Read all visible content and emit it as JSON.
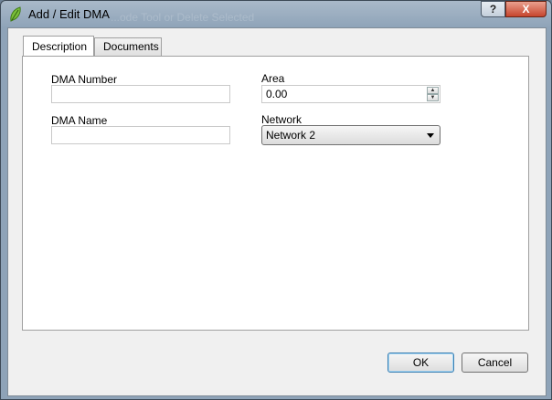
{
  "window": {
    "title": "Add / Edit DMA",
    "background_hint": "...ode Tool or Delete Selected",
    "help_label": "?",
    "close_label": "X",
    "app_icon": "qgis-leaf-icon"
  },
  "tabs": [
    {
      "label": "Description",
      "active": true
    },
    {
      "label": "Documents",
      "active": false
    }
  ],
  "form": {
    "dma_number": {
      "label": "DMA Number",
      "value": ""
    },
    "dma_name": {
      "label": "DMA Name",
      "value": ""
    },
    "area": {
      "label": "Area",
      "value": "0.00"
    },
    "network": {
      "label": "Network",
      "value": "Network 2"
    }
  },
  "buttons": {
    "ok": "OK",
    "cancel": "Cancel"
  },
  "colors": {
    "titlebar": "#8ea3b8",
    "close_button": "#c7452d",
    "default_button_border": "#3c7fb1"
  }
}
